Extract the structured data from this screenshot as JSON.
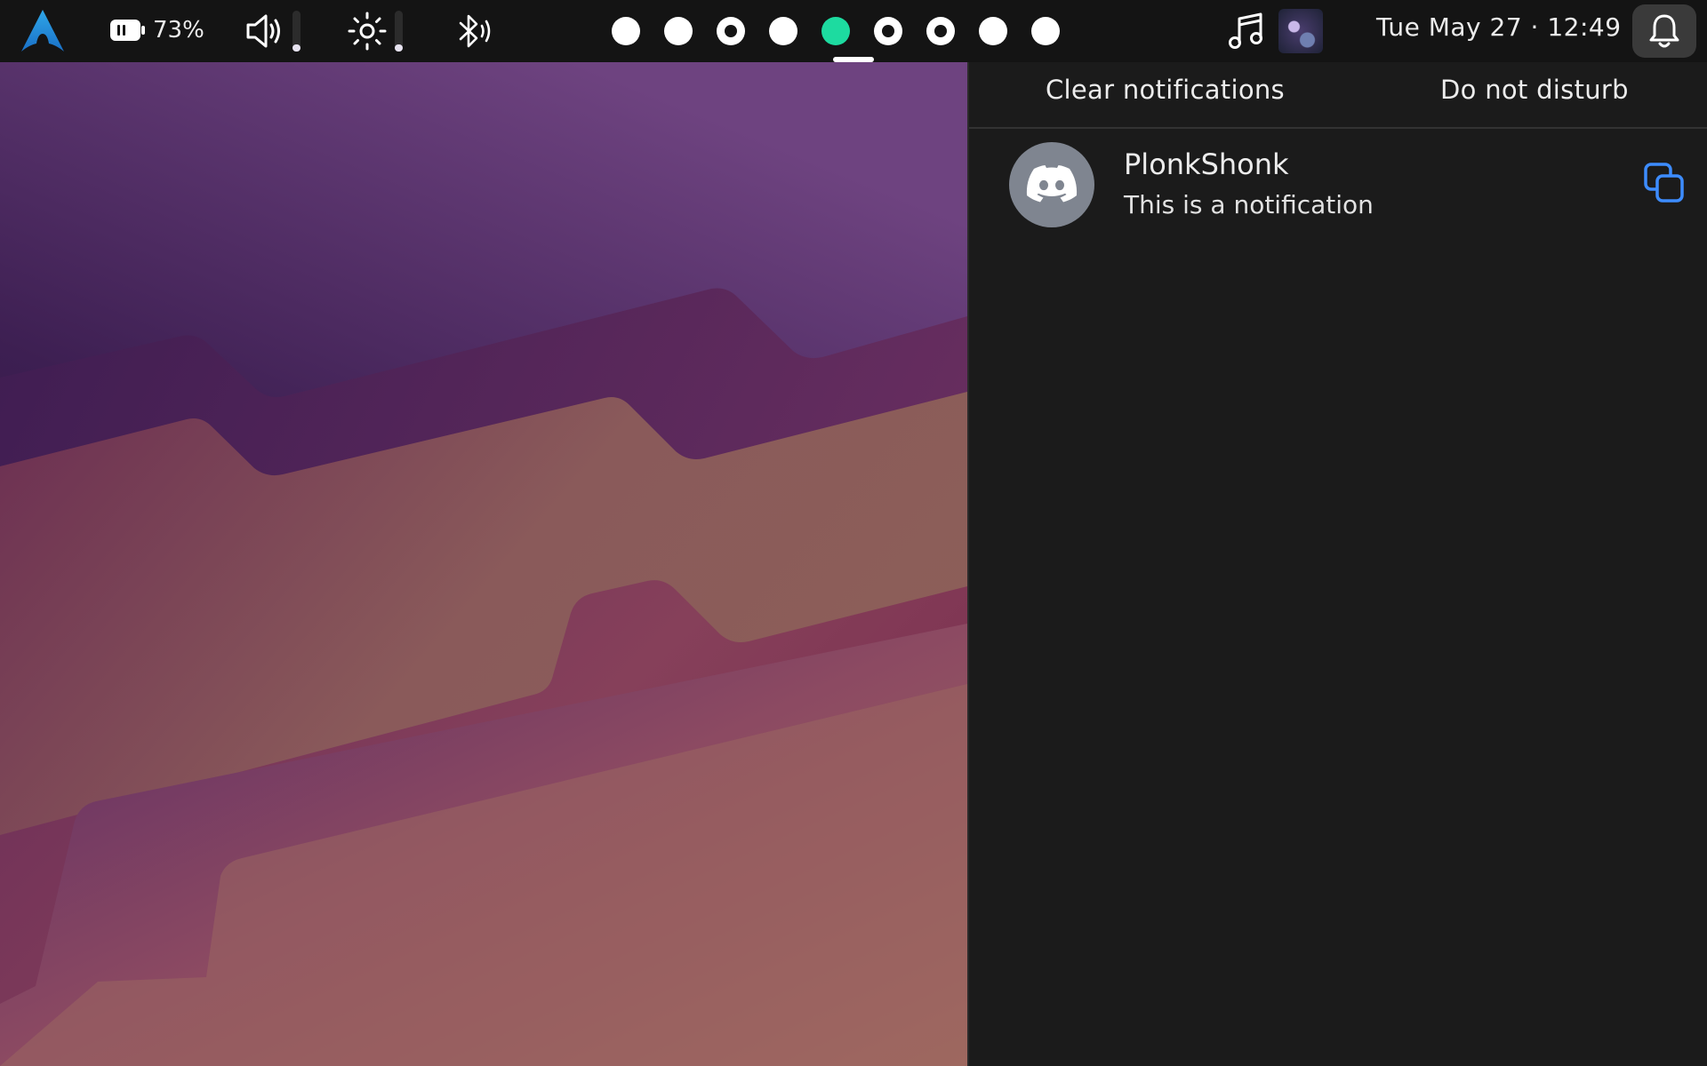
{
  "topbar": {
    "launcher_icon": "arch-logo-icon",
    "battery": {
      "percent_label": "73%",
      "icon": "battery-icon"
    },
    "volume": {
      "icon": "speaker-icon",
      "level": 0.18
    },
    "brightness": {
      "icon": "sun-icon",
      "level": 0.18
    },
    "bluetooth": {
      "icon": "bluetooth-icon"
    },
    "workspaces": [
      {
        "index": 1,
        "state": "empty"
      },
      {
        "index": 2,
        "state": "empty"
      },
      {
        "index": 3,
        "state": "occupied"
      },
      {
        "index": 4,
        "state": "empty"
      },
      {
        "index": 5,
        "state": "active"
      },
      {
        "index": 6,
        "state": "occupied"
      },
      {
        "index": 7,
        "state": "occupied"
      },
      {
        "index": 8,
        "state": "empty"
      },
      {
        "index": 9,
        "state": "empty"
      }
    ],
    "music_icon": "music-note-icon",
    "clock": "Tue May 27 · 12:49",
    "notification_icon": "bell-icon"
  },
  "notification_panel": {
    "clear_label": "Clear notifications",
    "dnd_label": "Do not disturb",
    "notifications": [
      {
        "app_icon": "discord-icon",
        "title": "PlonkShonk",
        "body": "This is a notification",
        "action_icon": "copy-icon"
      }
    ]
  },
  "colors": {
    "bar_background": "#141414",
    "panel_background": "#1b1b1b",
    "accent_active_workspace": "#1ddba0",
    "copy_icon": "#3d8cff",
    "avatar_background": "#7f8590"
  }
}
